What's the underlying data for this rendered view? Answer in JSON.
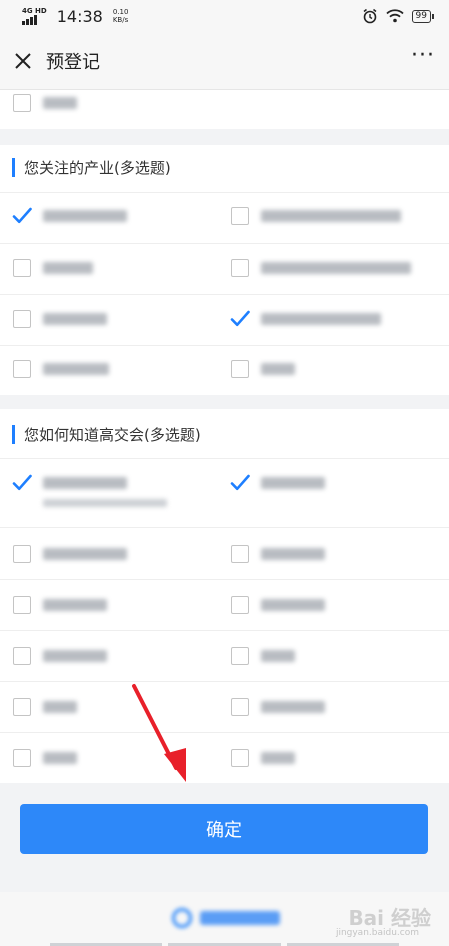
{
  "status_bar": {
    "network": "4G HD",
    "time": "14:38",
    "speed_value": "0.10",
    "speed_unit": "KB/s",
    "battery": "99"
  },
  "header": {
    "title": "预登记"
  },
  "sections": {
    "industry": {
      "title": "您关注的产业(多选题)"
    },
    "source": {
      "title": "您如何知道高交会(多选题)"
    }
  },
  "options": {
    "top_row": {
      "checked": false
    },
    "industry": [
      {
        "checked": true
      },
      {
        "checked": false
      },
      {
        "checked": false
      },
      {
        "checked": false
      },
      {
        "checked": false
      },
      {
        "checked": true
      },
      {
        "checked": false
      },
      {
        "checked": false
      }
    ],
    "source": [
      {
        "checked": true
      },
      {
        "checked": true
      },
      {
        "checked": false
      },
      {
        "checked": false
      },
      {
        "checked": false
      },
      {
        "checked": false
      },
      {
        "checked": false
      },
      {
        "checked": false
      },
      {
        "checked": false
      },
      {
        "checked": false
      },
      {
        "checked": false
      },
      {
        "checked": false
      }
    ]
  },
  "confirm_button": {
    "label": "确定"
  },
  "watermark": {
    "logo": "Bai 经验",
    "url": "jingyan.baidu.com"
  },
  "colors": {
    "accent": "#2d88f9",
    "checked": "#1e7fff",
    "arrow": "#e8202a"
  }
}
